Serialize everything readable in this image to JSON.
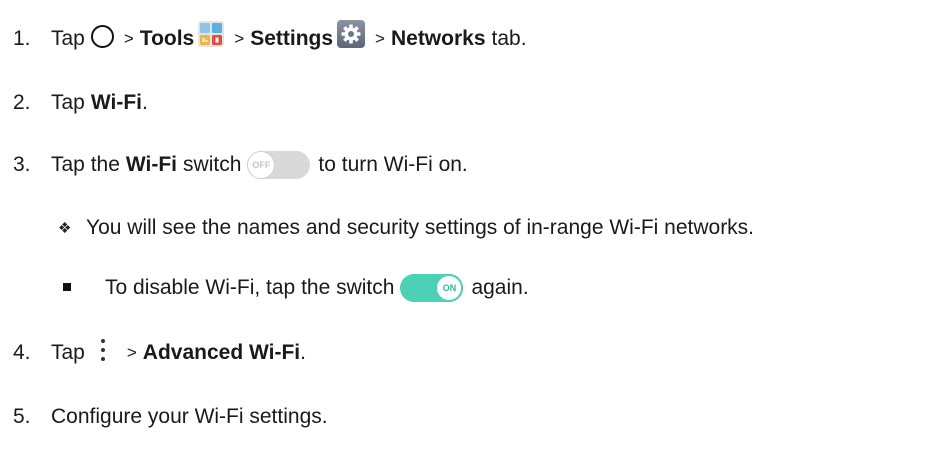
{
  "steps": {
    "s1": {
      "num": "1.",
      "tap": "Tap",
      "gt1": ">",
      "tools": "Tools",
      "gt2": ">",
      "settings": "Settings",
      "gt3": ">",
      "networks": "Networks",
      "tab": "tab."
    },
    "s2": {
      "num": "2.",
      "tap": "Tap",
      "wifi": "Wi-Fi",
      "period": "."
    },
    "s3": {
      "num": "3.",
      "pre": "Tap the",
      "wifi": "Wi-Fi",
      "switch_word": "switch",
      "post": "to turn Wi-Fi on.",
      "switch_label": "OFF"
    },
    "note": {
      "bullet": "❖",
      "text": "You will see the names and security settings of in-range Wi-Fi networks."
    },
    "sub": {
      "pre": "To disable Wi-Fi, tap the switch",
      "post": "again.",
      "switch_label": "ON"
    },
    "s4": {
      "num": "4.",
      "tap": "Tap",
      "gt": ">",
      "advanced": "Advanced Wi-Fi",
      "period": "."
    },
    "s5": {
      "num": "5.",
      "text": "Configure your Wi-Fi settings."
    }
  },
  "icons": {
    "home": "home-circle-icon",
    "tools": "tools-folder-icon",
    "settings": "settings-gear-icon",
    "menu": "more-options-icon"
  },
  "colors": {
    "switch_on": "#4cd0b6",
    "switch_off": "#d9d9d9",
    "text": "#1a1a1a"
  }
}
